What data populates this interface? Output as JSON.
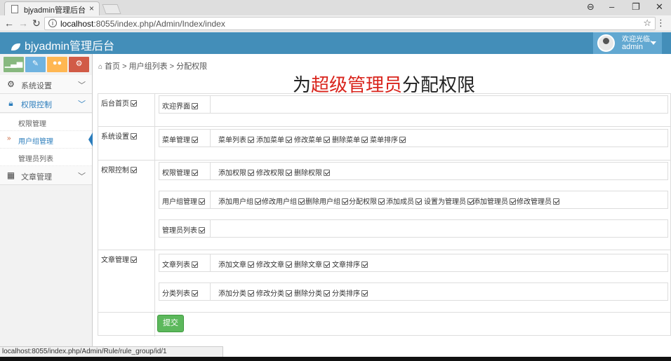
{
  "browser": {
    "tab_title": "bjyadmin管理后台",
    "tab_close": "×",
    "url_host": "localhost",
    "url_rest": ":8055/index.php/Admin/Index/index",
    "status_url": "localhost:8055/index.php/Admin/Rule/rule_group/id/1"
  },
  "header": {
    "brand": "bjyadmin管理后台",
    "welcome": "欢迎光临,",
    "username": "admin"
  },
  "sidebar": {
    "menus": [
      {
        "label": "系统设置",
        "icon": "gear-icon"
      },
      {
        "label": "权限控制",
        "icon": "lock-icon"
      },
      {
        "label": "文章管理",
        "icon": "grid-icon"
      }
    ],
    "sub_items": [
      "权限管理",
      "用户组管理",
      "管理员列表"
    ],
    "shortcut_colors": [
      "#87b87f",
      "#6fb3e0",
      "#ffb752",
      "#d15b47"
    ]
  },
  "breadcrumb": {
    "home": "首页",
    "sep": ">",
    "level1": "用户组列表",
    "level2": "分配权限"
  },
  "page_title": {
    "prefix": "为",
    "group": "超级管理员",
    "suffix": "分配权限"
  },
  "groups": [
    {
      "label": "后台首页",
      "rows": [
        {
          "name": "欢迎界面",
          "perms": []
        }
      ]
    },
    {
      "label": "系统设置",
      "rows": [
        {
          "name": "菜单管理",
          "perms": [
            "菜单列表",
            "添加菜单",
            "修改菜单",
            "删除菜单",
            "菜单排序"
          ]
        }
      ]
    },
    {
      "label": "权限控制",
      "rows": [
        {
          "name": "权限管理",
          "perms": [
            "添加权限",
            "修改权限",
            "删除权限"
          ]
        },
        {
          "name": "用户组管理",
          "perms": [
            "添加用户组",
            "修改用户组",
            "删除用户组",
            "分配权限",
            "添加成员",
            "设置为管理员",
            "添加管理员",
            "修改管理员"
          ]
        },
        {
          "name": "管理员列表",
          "perms": []
        }
      ]
    },
    {
      "label": "文章管理",
      "rows": [
        {
          "name": "文章列表",
          "perms": [
            "添加文章",
            "修改文章",
            "删除文章",
            "文章排序"
          ]
        },
        {
          "name": "分类列表",
          "perms": [
            "添加分类",
            "修改分类",
            "删除分类",
            "分类排序"
          ]
        }
      ]
    }
  ],
  "submit_label": "提交",
  "colors": {
    "header": "#438eb9",
    "title_highlight": "#d9241c",
    "submit": "#5cb85c"
  }
}
